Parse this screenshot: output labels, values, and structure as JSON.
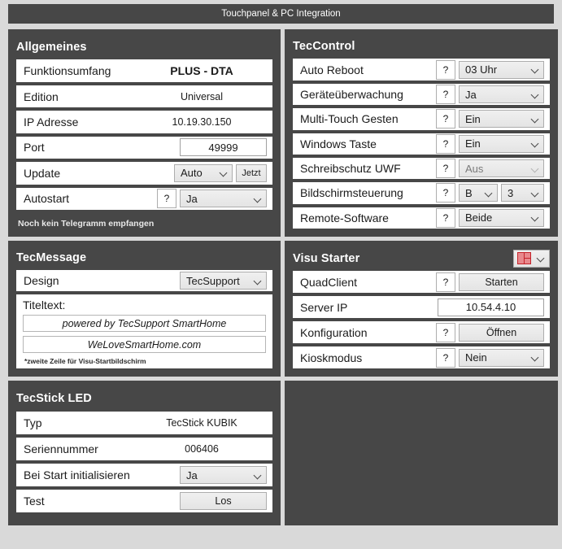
{
  "window": {
    "title": "Touchpanel & PC Integration"
  },
  "panels": {
    "allgemeines": {
      "title": "Allgemeines",
      "rows": [
        {
          "label": "Funktionsumfang",
          "value": "PLUS - DTA"
        },
        {
          "label": "Edition",
          "value": "Universal"
        },
        {
          "label": "IP Adresse",
          "value": "10.19.30.150"
        },
        {
          "label": "Port",
          "value": "49999"
        },
        {
          "label": "Update",
          "select": "Auto",
          "button": "Jetzt"
        },
        {
          "label": "Autostart",
          "help": "?",
          "select": "Ja"
        }
      ],
      "status": "Noch kein Telegramm empfangen"
    },
    "teccontrol": {
      "title": "TecControl",
      "rows": [
        {
          "label": "Auto Reboot",
          "help": "?",
          "select": "03 Uhr"
        },
        {
          "label": "Geräteüberwachung",
          "help": "?",
          "select": "Ja"
        },
        {
          "label": "Multi-Touch Gesten",
          "help": "?",
          "select": "Ein"
        },
        {
          "label": "Windows Taste",
          "help": "?",
          "select": "Ein"
        },
        {
          "label": "Schreibschutz UWF",
          "help": "?",
          "select": "Aus",
          "disabled": true
        },
        {
          "label": "Bildschirmsteuerung",
          "help": "?",
          "select": "B",
          "select2": "3"
        },
        {
          "label": "Remote-Software",
          "help": "?",
          "select": "Beide"
        }
      ]
    },
    "tecmessage": {
      "title": "TecMessage",
      "design_label": "Design",
      "design_value": "TecSupport",
      "titeltext_label": "Titeltext:",
      "line1": "powered by TecSupport SmartHome",
      "line2": "WeLoveSmartHome.com",
      "footnote": "*zweite Zeile für Visu-Startbildschirm"
    },
    "visustarter": {
      "title": "Visu Starter",
      "layout_icon": "layout-grid-icon",
      "rows": [
        {
          "label": "QuadClient",
          "help": "?",
          "button": "Starten"
        },
        {
          "label": "Server IP",
          "value": "10.54.4.10"
        },
        {
          "label": "Konfiguration",
          "help": "?",
          "button": "Öffnen"
        },
        {
          "label": "Kioskmodus",
          "help": "?",
          "select": "Nein"
        }
      ]
    },
    "tecstick": {
      "title": "TecStick LED",
      "rows": [
        {
          "label": "Typ",
          "value": "TecStick KUBIK"
        },
        {
          "label": "Seriennummer",
          "value": "006406"
        },
        {
          "label": "Bei Start initialisieren",
          "select": "Ja"
        },
        {
          "label": "Test",
          "button": "Los"
        }
      ]
    }
  },
  "colors": {
    "panel_bg": "#474747",
    "page_bg": "#d9d9d9",
    "row_bg": "#ffffff",
    "accent_red": "#c4232a"
  }
}
